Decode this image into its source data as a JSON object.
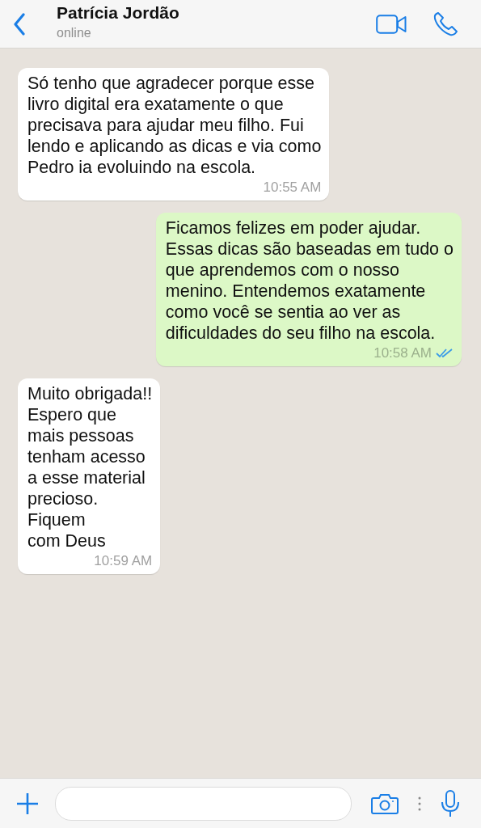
{
  "header": {
    "contact_name": "Patrícia Jordão",
    "status": "online"
  },
  "messages": [
    {
      "kind": "incoming",
      "text": "Só tenho que agradecer porque esse\nlivro digital era exatamente o que\nprecisava para ajudar meu filho. Fui\nlendo e aplicando as dicas e via como\nPedro ia evoluindo na escola.",
      "time": "10:55 AM",
      "read": false
    },
    {
      "kind": "outgoing",
      "text": "Ficamos felizes em poder ajudar.\nEssas dicas são baseadas em tudo o\nque aprendemos com o nosso\nmenino. Entendemos exatamente\ncomo você se sentia ao ver as\ndificuldades do seu filho na escola.",
      "time": "10:58 AM",
      "read": true
    },
    {
      "kind": "incoming",
      "text": "Muito obrigada!!\nEspero que\nmais pessoas\ntenham acesso\na esse material\nprecioso.\nFiquem\ncom Deus",
      "time": "10:59 AM",
      "read": false
    }
  ]
}
